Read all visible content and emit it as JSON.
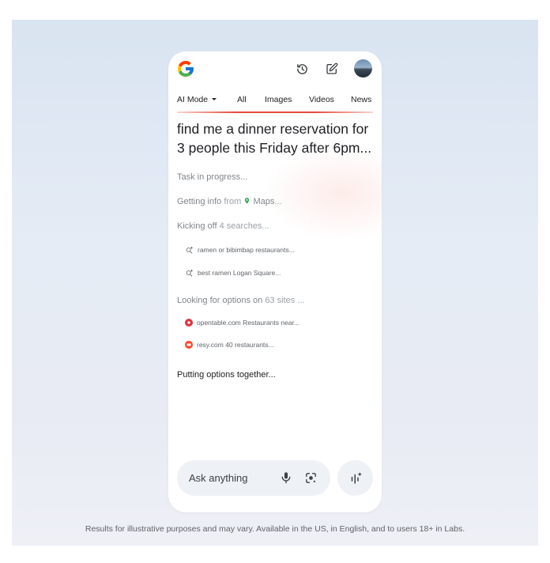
{
  "header": {
    "logo": "google-g-logo",
    "history_icon": "history-icon",
    "new_chat_icon": "edit-icon",
    "avatar": "avatar"
  },
  "tabs": [
    {
      "label": "AI Mode",
      "active": true
    },
    {
      "label": "All"
    },
    {
      "label": "Images"
    },
    {
      "label": "Videos"
    },
    {
      "label": "News"
    }
  ],
  "query": "find me a dinner reservation for 3 people this Friday after 6pm...",
  "progress": {
    "task": "Task in progress...",
    "getting_info": {
      "lead": "Getting info",
      "from": "from",
      "source": "Maps",
      "ellipsis": "..."
    },
    "kicking_off": {
      "lead": "Kicking off",
      "rest": "4 searches..."
    },
    "searches": [
      "ramen or bibimbap restaurants...",
      "best ramen Logan Square..."
    ],
    "looking": {
      "lead": "Looking for options on",
      "rest": "63 sites ..."
    },
    "sites": [
      {
        "text": "opentable.com Restaurants near...",
        "color": "#da3743"
      },
      {
        "text": "resy.com 40 restaurants...",
        "color": "#ff462d"
      }
    ],
    "final": "Putting options together..."
  },
  "input": {
    "placeholder": "Ask anything"
  },
  "footnote": "Results for illustrative purposes and may vary. Available in the US, in English, and to users 18+ in Labs.",
  "colors": {
    "accent_line": "#e54b3c",
    "background": "#dfe7f2"
  }
}
